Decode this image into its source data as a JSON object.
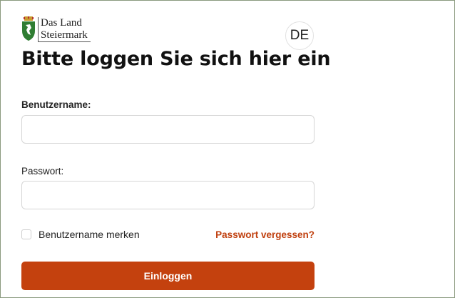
{
  "logo": {
    "line1": "Das Land",
    "line2": "Steiermark"
  },
  "language": "DE",
  "heading": "Bitte loggen Sie sich hier ein",
  "form": {
    "username_label": "Benutzername:",
    "username_value": "",
    "password_label": "Passwort:",
    "password_value": "",
    "remember_label": "Benutzername merken",
    "remember_checked": false,
    "forgot_link": "Passwort vergessen?",
    "submit_label": "Einloggen"
  },
  "colors": {
    "accent": "#c4410e",
    "crest_green": "#2f7d32"
  }
}
